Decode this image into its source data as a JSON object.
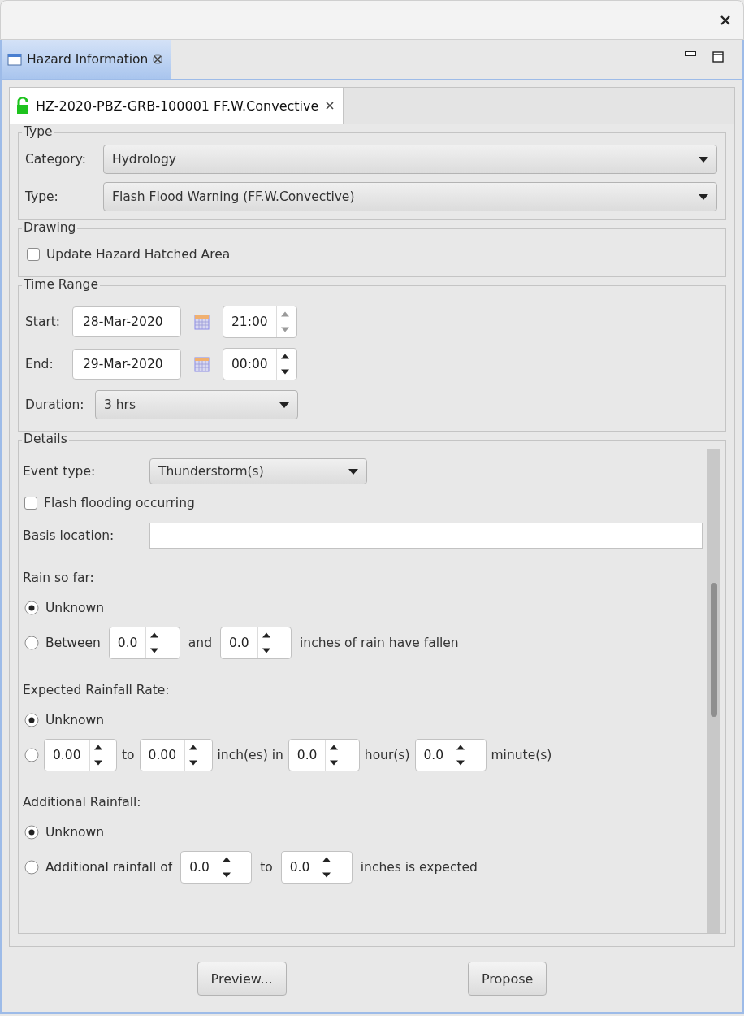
{
  "view_tab": {
    "label": "Hazard Information",
    "selected": true
  },
  "hazard_tab": {
    "label": "HZ-2020-PBZ-GRB-100001 FF.W.Convective",
    "selected": true
  },
  "type_group": {
    "title": "Type",
    "fields": [
      {
        "label": "Category:",
        "value": "Hydrology"
      },
      {
        "label": "Type:",
        "value": "Flash Flood Warning (FF.W.Convective)"
      }
    ]
  },
  "drawing_group": {
    "title": "Drawing",
    "checkbox": {
      "label": "Update Hazard Hatched Area",
      "checked": false
    }
  },
  "time_range": {
    "title": "Time Range",
    "rows": [
      {
        "label": "Start:",
        "date": "28-Mar-2020",
        "time": "21:00",
        "spinner_enabled": false
      },
      {
        "label": "End:",
        "date": "29-Mar-2020",
        "time": "00:00",
        "spinner_enabled": true
      }
    ],
    "duration": {
      "label": "Duration:",
      "value": "3 hrs"
    }
  },
  "details": {
    "title": "Details",
    "items": [
      {
        "kind": "combo",
        "label": "Event type:",
        "value": "Thunderstorm(s)"
      },
      {
        "kind": "check",
        "label": "Flash flooding occurring",
        "checked": false
      },
      {
        "kind": "text",
        "label": "Basis location:"
      },
      {
        "kind": "heading",
        "text": "Rain so far:"
      },
      {
        "kind": "radio",
        "selected": true,
        "parts": [
          {
            "kind": "label",
            "text": "Unknown"
          }
        ]
      },
      {
        "kind": "radio",
        "selected": false,
        "parts": [
          {
            "kind": "label",
            "text": "Between"
          },
          {
            "kind": "spin",
            "value": "0.0"
          },
          {
            "kind": "label",
            "text": "and"
          },
          {
            "kind": "spin",
            "value": "0.0"
          },
          {
            "kind": "label",
            "text": "inches of rain have fallen"
          }
        ]
      },
      {
        "kind": "heading",
        "text": "Expected Rainfall Rate:"
      },
      {
        "kind": "radio",
        "selected": true,
        "parts": [
          {
            "kind": "label",
            "text": "Unknown"
          }
        ]
      },
      {
        "kind": "radio",
        "selected": false,
        "parts": [
          {
            "kind": "spin",
            "value": "0.00"
          },
          {
            "kind": "label",
            "text": "to"
          },
          {
            "kind": "spin",
            "value": "0.00"
          },
          {
            "kind": "label",
            "text": "inch(es) in"
          },
          {
            "kind": "spin",
            "value": "0.0"
          },
          {
            "kind": "label",
            "text": "hour(s)"
          },
          {
            "kind": "spin",
            "value": "0.0"
          },
          {
            "kind": "label",
            "text": "minute(s)"
          }
        ]
      },
      {
        "kind": "heading",
        "text": "Additional Rainfall:"
      },
      {
        "kind": "radio",
        "selected": true,
        "parts": [
          {
            "kind": "label",
            "text": "Unknown"
          }
        ]
      },
      {
        "kind": "radio",
        "selected": false,
        "parts": [
          {
            "kind": "label",
            "text": "Additional rainfall of"
          },
          {
            "kind": "spin",
            "value": "0.0"
          },
          {
            "kind": "label",
            "text": "to"
          },
          {
            "kind": "spin",
            "value": "0.0"
          },
          {
            "kind": "label",
            "text": "inches is expected"
          }
        ]
      }
    ]
  },
  "buttons": [
    "Preview...",
    "Propose"
  ]
}
